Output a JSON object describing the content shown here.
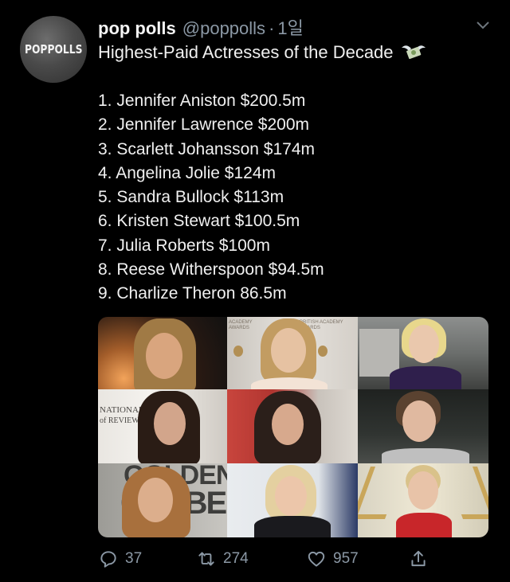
{
  "profile": {
    "avatar_text": "POPPOLLS",
    "name": "pop polls",
    "handle": "@poppolls",
    "time": "1일"
  },
  "tweet": {
    "title": "Highest-Paid Actresses of the Decade",
    "list": [
      "1. Jennifer Aniston $200.5m",
      "2. Jennifer Lawrence $200m",
      "3. Scarlett Johansson $174m",
      "4. Angelina Jolie $124m",
      "5. Sandra Bullock $113m",
      "6. Kristen Stewart $100.5m",
      "7. Julia Roberts $100m",
      "8. Reese Witherspoon $94.5m",
      "9. Charlize Theron 86.5m"
    ]
  },
  "photo_texts": {
    "bafta_left": "ACADEMY AWARDS",
    "bafta_right": "BRITISH ACADEMY AWARDS",
    "national": "NATIONAL",
    "review": "of REVIEW",
    "golden": "GOLDEN",
    "globe": "GLOBE"
  },
  "actions": {
    "replies": "37",
    "retweets": "274",
    "likes": "957"
  },
  "icons": [
    "chevron-down-icon",
    "money-wings-icon",
    "reply-icon",
    "retweet-icon",
    "like-icon",
    "share-icon"
  ]
}
